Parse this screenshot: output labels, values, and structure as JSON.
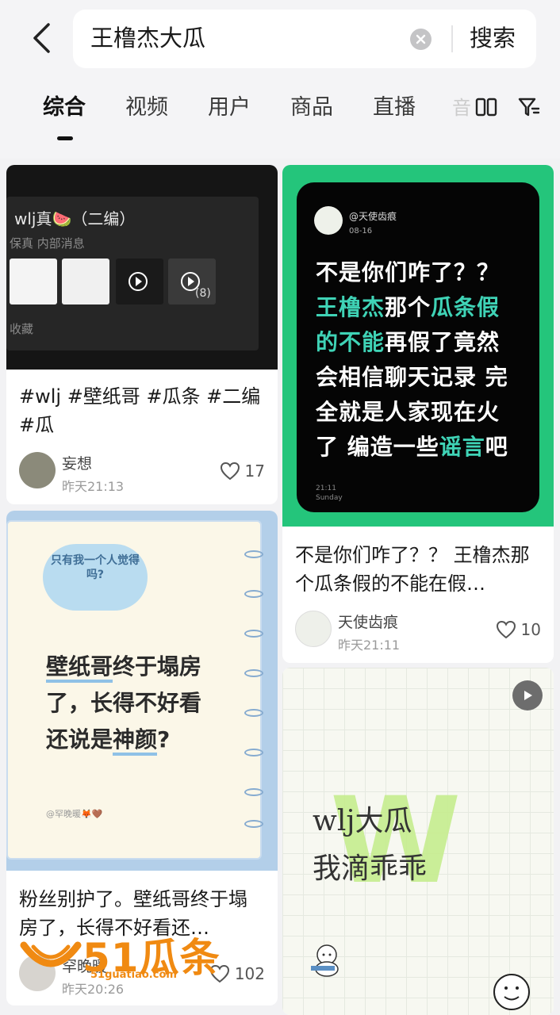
{
  "search": {
    "query": "王橹杰大瓜",
    "button": "搜索"
  },
  "tabs": [
    "综合",
    "视频",
    "用户",
    "商品",
    "直播",
    "音"
  ],
  "cards": [
    {
      "image": {
        "panel_title": "wlj真🍉（二编）",
        "panel_note": "保真  内部消息",
        "panel_footer": "收藏",
        "video_count": "(8)"
      },
      "title": "#wlj #壁纸哥 #瓜条 #二编 #瓜",
      "author": "妄想",
      "time": "昨天21:13",
      "likes": "17"
    },
    {
      "image": {
        "handle": "@天使齿痕",
        "date": "08-16",
        "line1": "不是你们咋了？？",
        "hl1": "王橹杰",
        "line2a": "那个",
        "hl2": "瓜条假",
        "hl3": "的不能",
        "line3": "再假了竟然",
        "line4": "会相信聊天记录 完",
        "line5": "全就是人家现在火",
        "line6": "了 编造一些",
        "hl4": "谣言",
        "line6b": "吧",
        "foot_time": "21:11",
        "foot_day": "Sunday"
      },
      "title": "不是你们咋了？？ 王橹杰那个瓜条假的不能在假…",
      "author": "天使齿痕",
      "time": "昨天21:11",
      "likes": "10"
    },
    {
      "image": {
        "bubble": "只有我一个人觉得吗?",
        "u1": "壁纸哥",
        "t1": "终于塌房",
        "t2": "了，长得不好看",
        "t3": "还说是",
        "u2": "神颜",
        "t4": "?",
        "signature": "@罕晚暖🦊🤎"
      },
      "title": "粉丝别护了。壁纸哥终于塌房了，长得不好看还…",
      "author": "罕晚暖",
      "time": "昨天20:26",
      "likes": "102"
    },
    {
      "image": {
        "line1": "wlj大瓜",
        "line2": "我滴乖乖"
      }
    }
  ],
  "watermark": {
    "brand": "51瓜条",
    "url": "51guatiao.com"
  }
}
